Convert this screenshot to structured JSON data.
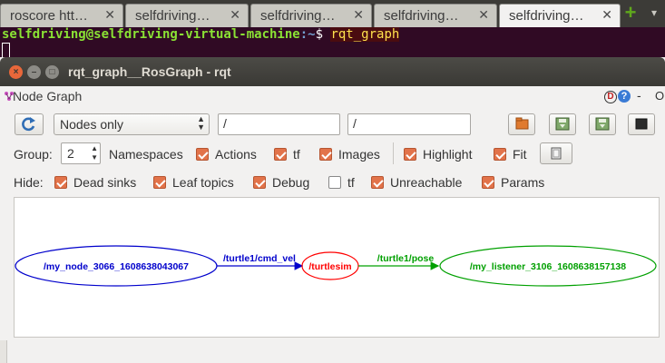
{
  "terminal": {
    "tabs": [
      {
        "label": "roscore htt…"
      },
      {
        "label": "selfdriving…"
      },
      {
        "label": "selfdriving…"
      },
      {
        "label": "selfdriving…"
      },
      {
        "label": "selfdriving…"
      }
    ],
    "tab_close": "✕",
    "add_tab": "+",
    "menu_arrow": "▾",
    "prompt_user_host": "selfdriving@selfdriving-virtual-machine",
    "prompt_path": ":~",
    "prompt_dollar": "$ ",
    "command": "rqt_graph",
    "colors": {
      "user": "#8ae234",
      "path": "#729fcf",
      "command": "#ffe14d",
      "background": "#300a24"
    }
  },
  "window": {
    "title": "rqt_graph__RosGraph - rqt",
    "close_glyph": "×",
    "min_glyph": "–",
    "max_glyph": "□"
  },
  "plugin": {
    "title": "Node Graph",
    "d_label": "D",
    "help_label": "?",
    "dash_label": "-",
    "o_label": "O"
  },
  "toolbar": {
    "refresh_icon": "refresh-icon",
    "mode_select": "Nodes only",
    "node_filter": "/",
    "topic_filter": "/",
    "icons": [
      "open-folder-icon",
      "save-dot-icon",
      "save-image-icon",
      "screenshot-icon"
    ]
  },
  "options": {
    "group_label": "Group:",
    "group_value": "2",
    "namespaces_label": "Namespaces",
    "actions": {
      "label": "Actions",
      "checked": true
    },
    "tf": {
      "label": "tf",
      "checked": true
    },
    "images": {
      "label": "Images",
      "checked": true
    },
    "highlight": {
      "label": "Highlight",
      "checked": true
    },
    "fit": {
      "label": "Fit",
      "checked": true
    }
  },
  "hide": {
    "label": "Hide:",
    "items": [
      {
        "label": "Dead sinks",
        "checked": true
      },
      {
        "label": "Leaf topics",
        "checked": true
      },
      {
        "label": "Debug",
        "checked": true
      },
      {
        "label": "tf",
        "checked": false
      },
      {
        "label": "Unreachable",
        "checked": true
      },
      {
        "label": "Params",
        "checked": true
      }
    ]
  },
  "graph": {
    "nodes": [
      {
        "label": "/my_node_3066_1608638043067",
        "color": "#0000cc"
      },
      {
        "label": "/turtlesim",
        "color": "#ff0000"
      },
      {
        "label": "/my_listener_3106_1608638157138",
        "color": "#00a000"
      }
    ],
    "edges": [
      {
        "label": "/turtle1/cmd_vel",
        "color": "#0000cc"
      },
      {
        "label": "/turtle1/pose",
        "color": "#00a000"
      }
    ]
  }
}
